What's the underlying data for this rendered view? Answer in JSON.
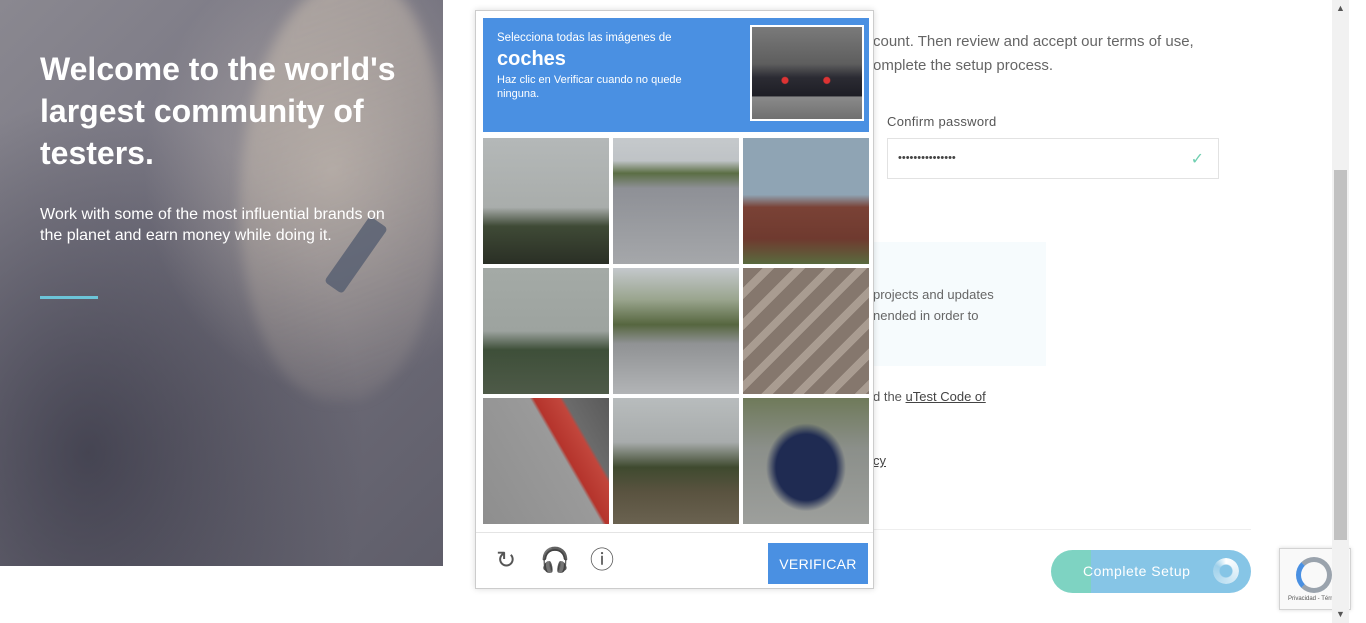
{
  "hero": {
    "title": "Welcome to the world's largest community of testers.",
    "subtitle": "Work with some of the most influential brands on the planet and earn money while doing it."
  },
  "form": {
    "intro_line1": "count. Then review and accept our terms of use,",
    "intro_line2": "omplete the setup process.",
    "confirm_label": "Confirm password",
    "confirm_value": "•••••••••••••••",
    "info_line1": "projects and updates",
    "info_line2": "nended in order to",
    "code_prefix": "d the ",
    "code_link": "uTest Code of",
    "privacy_fragment": "cy",
    "complete_button": "Complete Setup"
  },
  "captcha": {
    "instruction_line1": "Selecciona todas las imágenes de",
    "target": "coches",
    "instruction_line2": "Haz clic en Verificar cuando no quede ninguna.",
    "verify_button": "VERIFICAR",
    "tiles": [
      "palm-trees-tile",
      "road-car-tile",
      "house-tile",
      "palm-tree-tile",
      "street-cars-tile",
      "crosswalk-tile",
      "fire-lane-tile",
      "palms-tile",
      "blue-car-tile"
    ]
  },
  "recaptcha_badge": {
    "text": "Privacidad - Términos"
  },
  "colors": {
    "captcha_blue": "#4a90e2",
    "accent": "#6cc4d8",
    "button_teal": "#7ed3c2",
    "button_blue": "#86c5e6"
  }
}
